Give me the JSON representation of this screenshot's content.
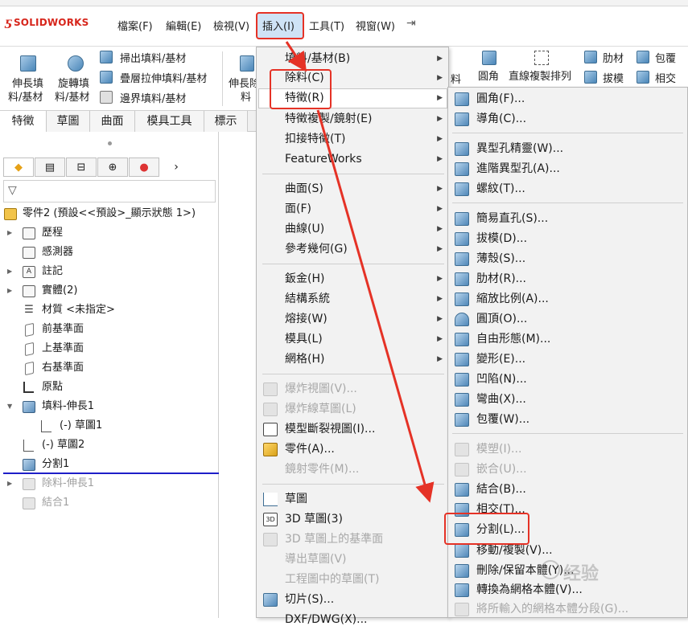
{
  "app": {
    "name": "SOLIDWORKS"
  },
  "menubar": {
    "items": [
      "檔案(F)",
      "編輯(E)",
      "檢視(V)",
      "插入(I)",
      "工具(T)",
      "視窗(W)"
    ]
  },
  "ribbon": {
    "big_buttons": [
      {
        "line1": "伸長填",
        "line2": "料/基材"
      },
      {
        "line1": "旋轉填",
        "line2": "料/基材"
      }
    ],
    "small_buttons": [
      "掃出填料/基材",
      "疊層拉伸填料/基材",
      "邊界填料/基材"
    ],
    "partial_button": {
      "line1": "伸長除",
      "line2": "料"
    },
    "right_buttons": [
      "圓角",
      "直線複製排列",
      "肋材",
      "拔模",
      "包覆",
      "相交"
    ],
    "partial_right": "料"
  },
  "tabs": [
    "特徵",
    "草圖",
    "曲面",
    "模具工具",
    "標示"
  ],
  "tree": {
    "root": "零件2 (預設<<預設>_顯示狀態 1>)",
    "items": [
      "歷程",
      "感測器",
      "註記",
      "實體(2)",
      "材質 <未指定>",
      "前基準面",
      "上基準面",
      "右基準面",
      "原點",
      "填料-伸長1",
      "(-) 草圖1",
      "(-) 草圖2",
      "分割1",
      "除料-伸長1",
      "結合1"
    ]
  },
  "menu_insert": {
    "items": [
      "填料/基材(B)",
      "除料(C)",
      "特徵(R)",
      "特徵複製/鏡射(E)",
      "扣接特徵(T)",
      "FeatureWorks",
      "曲面(S)",
      "面(F)",
      "曲線(U)",
      "參考幾何(G)",
      "鈑金(H)",
      "結構系統",
      "熔接(W)",
      "模具(L)",
      "網格(H)",
      "爆炸視圖(V)...",
      "爆炸線草圖(L)",
      "模型斷裂視圖(I)...",
      "零件(A)...",
      "鏡射零件(M)...",
      "草圖",
      "3D 草圖(3)",
      "3D 草圖上的基準面",
      "導出草圖(V)",
      "工程圖中的草圖(T)",
      "切片(S)...",
      "DXF/DWG(X)..."
    ]
  },
  "menu_features": {
    "items": [
      "圓角(F)...",
      "導角(C)...",
      "異型孔精靈(W)...",
      "進階異型孔(A)...",
      "螺紋(T)...",
      "簡易直孔(S)...",
      "拔模(D)...",
      "薄殼(S)...",
      "肋材(R)...",
      "縮放比例(A)...",
      "圓頂(O)...",
      "自由形態(M)...",
      "變形(E)...",
      "凹陷(N)...",
      "彎曲(X)...",
      "包覆(W)...",
      "模塑(I)...",
      "嵌合(U)...",
      "結合(B)...",
      "相交(T)...",
      "分割(L)...",
      "移動/複製(V)...",
      "刪除/保留本體(Y)...",
      "轉換為網格本體(V)...",
      "將所輸入的網格本體分段(G)..."
    ]
  },
  "watermark": "经验",
  "colors": {
    "annotation_red": "#e53226",
    "brand_red": "#d7261c",
    "selection_line": "#1e1ec8"
  }
}
